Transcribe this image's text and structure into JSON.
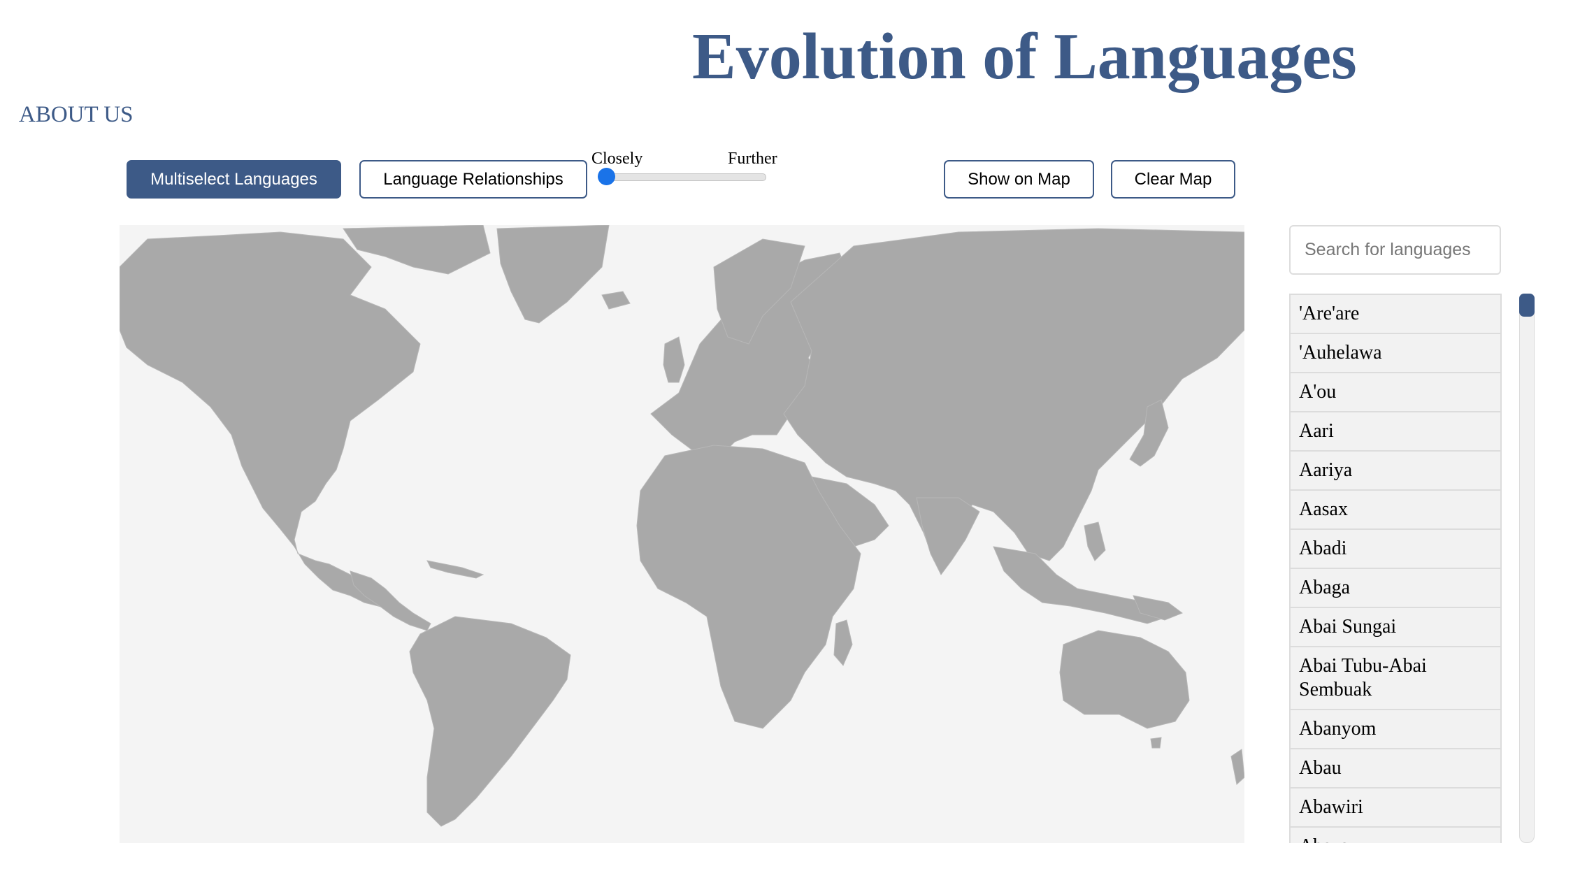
{
  "header": {
    "title": "Evolution of Languages",
    "about_link": "ABOUT US"
  },
  "toolbar": {
    "multiselect_label": "Multiselect Languages",
    "relationships_label": "Language Relationships",
    "slider": {
      "min_label": "Closely",
      "max_label": "Further",
      "value": 0
    },
    "show_on_map_label": "Show on Map",
    "clear_map_label": "Clear Map"
  },
  "map": {
    "land_color": "#a9a9a9",
    "ocean_color": "#f4f4f4"
  },
  "search": {
    "placeholder": "Search for languages"
  },
  "languages": [
    "'Are'are",
    "'Auhelawa",
    "A'ou",
    "Aari",
    "Aariya",
    "Aasax",
    "Abadi",
    "Abaga",
    "Abai Sungai",
    "Abai Tubu-Abai Sembuak",
    "Abanyom",
    "Abau",
    "Abawiri",
    "Abaza"
  ],
  "colors": {
    "accent": "#3d5a87",
    "slider_thumb": "#1a73e8"
  }
}
